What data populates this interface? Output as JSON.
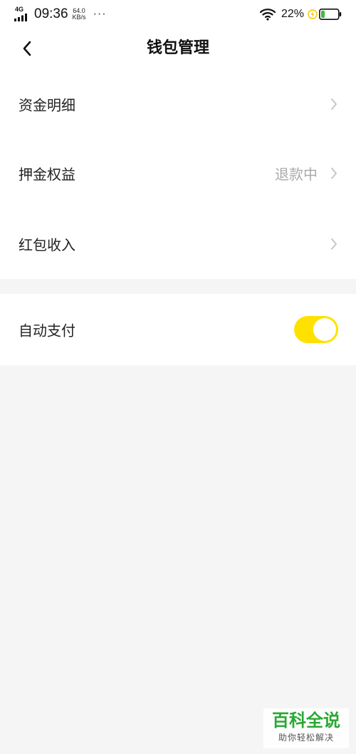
{
  "status_bar": {
    "network": "4G",
    "time": "09:36",
    "speed_value": "64.0",
    "speed_unit": "KB/s",
    "more": "···",
    "battery": "22%",
    "battery_level": 0.22
  },
  "nav": {
    "title": "钱包管理"
  },
  "menu": {
    "items": [
      {
        "label": "资金明细",
        "value": ""
      },
      {
        "label": "押金权益",
        "value": "退款中"
      },
      {
        "label": "红包收入",
        "value": ""
      }
    ]
  },
  "settings": {
    "auto_pay_label": "自动支付",
    "auto_pay_enabled": true
  },
  "watermark": {
    "title": "百科全说",
    "subtitle": "助你轻松解决"
  },
  "colors": {
    "accent": "#ffe100",
    "background": "#f5f5f5",
    "charge": "#f4c400",
    "battery_fill": "#3dbd3d"
  }
}
